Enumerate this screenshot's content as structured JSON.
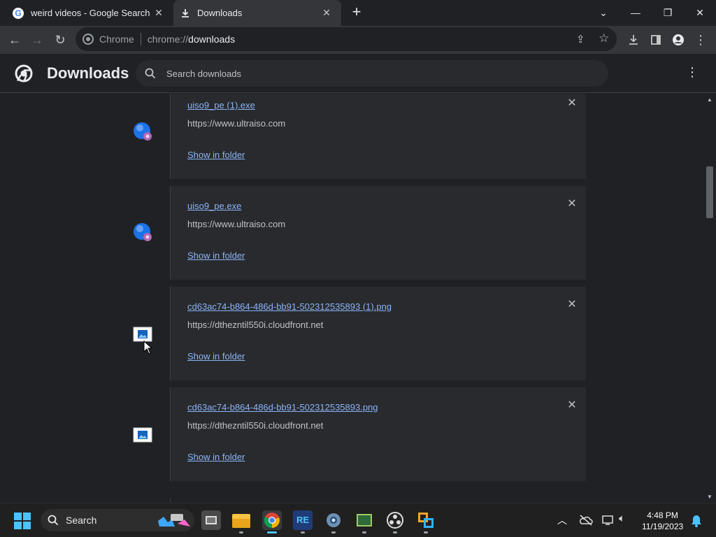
{
  "tabs": [
    {
      "title": "weird videos - Google Search",
      "icon": "google-g-icon"
    },
    {
      "title": "Downloads",
      "icon": "download-icon",
      "active": true
    }
  ],
  "omnibox": {
    "chip_label": "Chrome",
    "url_scheme": "chrome://",
    "url_path": "downloads"
  },
  "page": {
    "title": "Downloads",
    "search_placeholder": "Search downloads"
  },
  "downloads": [
    {
      "filename": "uiso9_pe (1).exe",
      "source": "https://www.ultraiso.com",
      "action": "Show in folder",
      "icon": "globe-exe-icon"
    },
    {
      "filename": "uiso9_pe.exe",
      "source": "https://www.ultraiso.com",
      "action": "Show in folder",
      "icon": "globe-exe-icon"
    },
    {
      "filename": "cd63ac74-b864-486d-bb91-502312535893 (1).png",
      "source": "https://dthezntil550i.cloudfront.net",
      "action": "Show in folder",
      "icon": "image-file-icon"
    },
    {
      "filename": "cd63ac74-b864-486d-bb91-502312535893.png",
      "source": "https://dthezntil550i.cloudfront.net",
      "action": "Show in folder",
      "icon": "image-file-icon"
    }
  ],
  "taskbar": {
    "search_label": "Search",
    "time": "4:48 PM",
    "date": "11/19/2023"
  },
  "colors": {
    "background": "#202124",
    "card": "#292a2d",
    "link": "#8ab4f8",
    "text": "#bdc1c6"
  }
}
